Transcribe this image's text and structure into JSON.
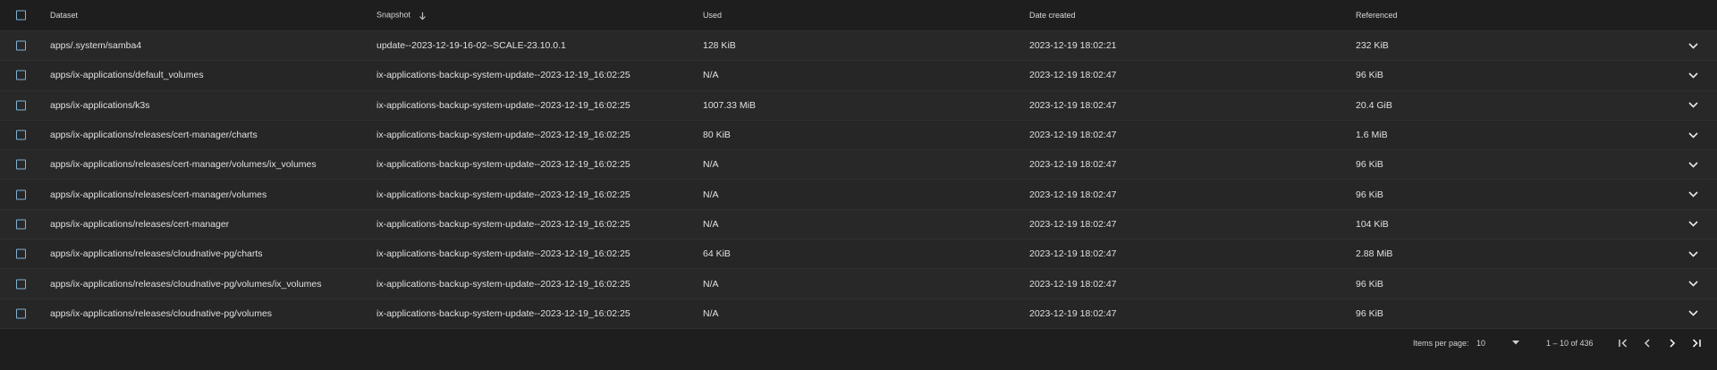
{
  "columns": {
    "dataset": "Dataset",
    "snapshot": "Snapshot",
    "used": "Used",
    "date_created": "Date created",
    "referenced": "Referenced"
  },
  "rows": [
    {
      "dataset": "apps/.system/samba4",
      "snapshot": "update--2023-12-19-16-02--SCALE-23.10.0.1",
      "used": "128 KiB",
      "date": "2023-12-19 18:02:21",
      "referenced": "232 KiB"
    },
    {
      "dataset": "apps/ix-applications/default_volumes",
      "snapshot": "ix-applications-backup-system-update--2023-12-19_16:02:25",
      "used": "N/A",
      "date": "2023-12-19 18:02:47",
      "referenced": "96 KiB"
    },
    {
      "dataset": "apps/ix-applications/k3s",
      "snapshot": "ix-applications-backup-system-update--2023-12-19_16:02:25",
      "used": "1007.33 MiB",
      "date": "2023-12-19 18:02:47",
      "referenced": "20.4 GiB"
    },
    {
      "dataset": "apps/ix-applications/releases/cert-manager/charts",
      "snapshot": "ix-applications-backup-system-update--2023-12-19_16:02:25",
      "used": "80 KiB",
      "date": "2023-12-19 18:02:47",
      "referenced": "1.6 MiB"
    },
    {
      "dataset": "apps/ix-applications/releases/cert-manager/volumes/ix_volumes",
      "snapshot": "ix-applications-backup-system-update--2023-12-19_16:02:25",
      "used": "N/A",
      "date": "2023-12-19 18:02:47",
      "referenced": "96 KiB"
    },
    {
      "dataset": "apps/ix-applications/releases/cert-manager/volumes",
      "snapshot": "ix-applications-backup-system-update--2023-12-19_16:02:25",
      "used": "N/A",
      "date": "2023-12-19 18:02:47",
      "referenced": "96 KiB"
    },
    {
      "dataset": "apps/ix-applications/releases/cert-manager",
      "snapshot": "ix-applications-backup-system-update--2023-12-19_16:02:25",
      "used": "N/A",
      "date": "2023-12-19 18:02:47",
      "referenced": "104 KiB"
    },
    {
      "dataset": "apps/ix-applications/releases/cloudnative-pg/charts",
      "snapshot": "ix-applications-backup-system-update--2023-12-19_16:02:25",
      "used": "64 KiB",
      "date": "2023-12-19 18:02:47",
      "referenced": "2.88 MiB"
    },
    {
      "dataset": "apps/ix-applications/releases/cloudnative-pg/volumes/ix_volumes",
      "snapshot": "ix-applications-backup-system-update--2023-12-19_16:02:25",
      "used": "N/A",
      "date": "2023-12-19 18:02:47",
      "referenced": "96 KiB"
    },
    {
      "dataset": "apps/ix-applications/releases/cloudnative-pg/volumes",
      "snapshot": "ix-applications-backup-system-update--2023-12-19_16:02:25",
      "used": "N/A",
      "date": "2023-12-19 18:02:47",
      "referenced": "96 KiB"
    }
  ],
  "paginator": {
    "items_per_page_label": "Items per page:",
    "page_size": "10",
    "range_label": "1 – 10 of 436"
  },
  "icons": {
    "sort": "arrow-down-icon",
    "expand": "chevron-down-icon",
    "dropdown": "caret-down-icon",
    "first": "first-page-icon",
    "prev": "chevron-left-icon",
    "next": "chevron-right-icon",
    "last": "last-page-icon"
  },
  "colors": {
    "background": "#1e1e1e",
    "row": "#272727",
    "checkbox": "#7fb3d8",
    "text": "#e0e0e0"
  }
}
